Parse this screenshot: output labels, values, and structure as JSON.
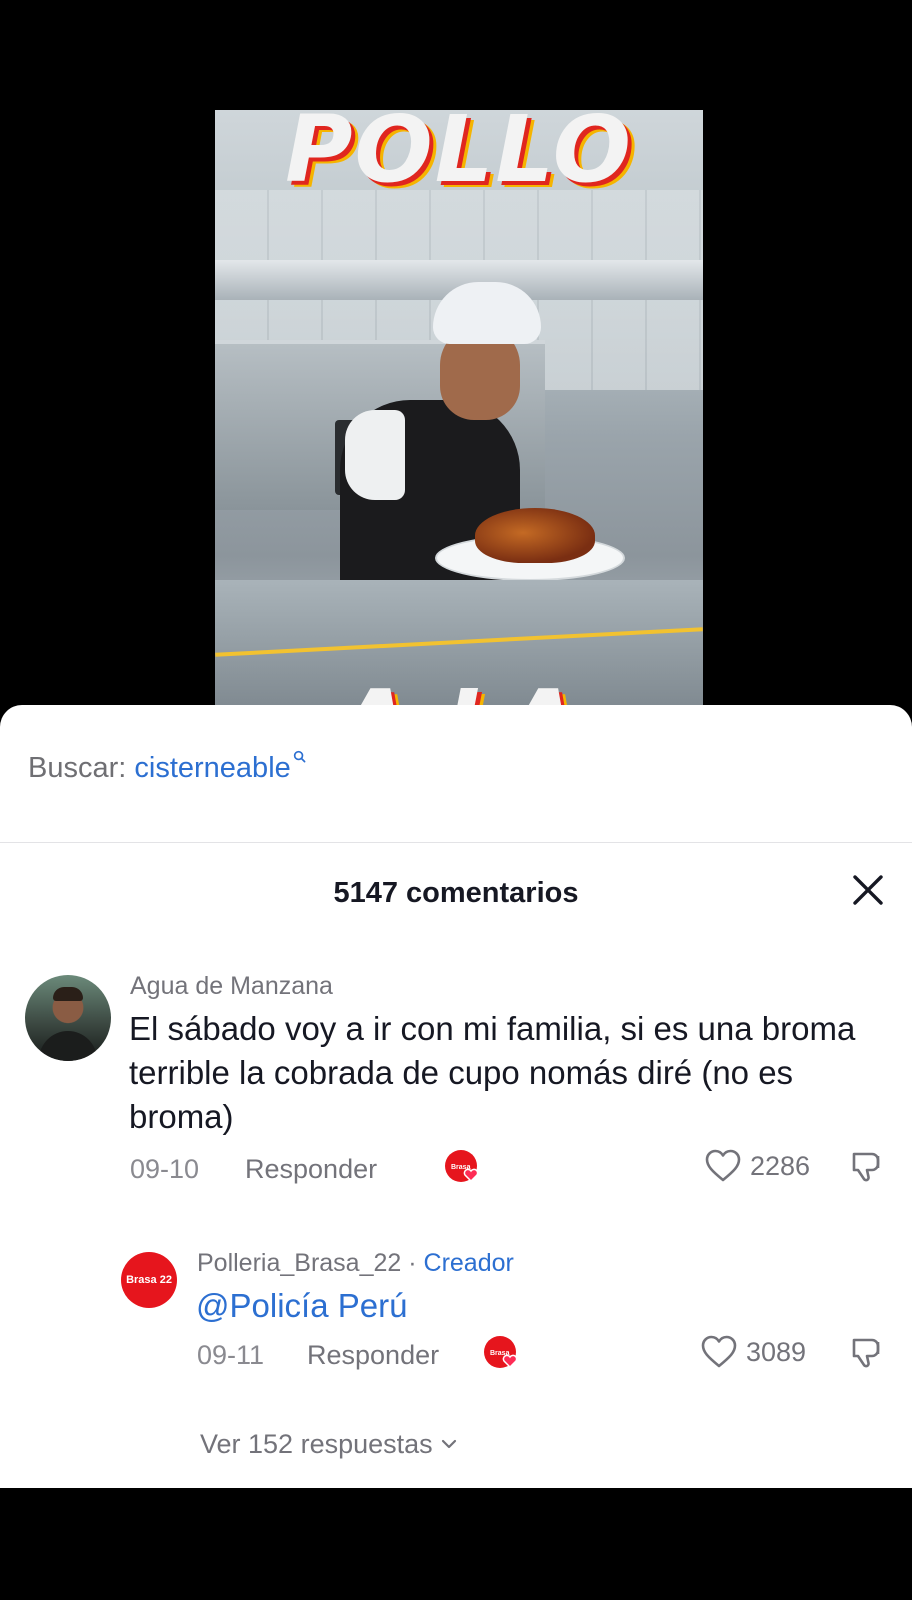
{
  "video": {
    "title_top": "POLLO",
    "title_bottom": "A LA BRASA"
  },
  "search": {
    "prefix": "Buscar:",
    "term": "cisterneable"
  },
  "comments_header": {
    "count_label": "5147 comentarios"
  },
  "comments": [
    {
      "username": "Agua de Manzana",
      "text": "El sábado voy a ir con mi familia, si es una broma terrible la cobrada de cupo nomás diré (no es broma)",
      "date": "09-10",
      "reply_label": "Responder",
      "likes": "2286"
    }
  ],
  "reply": {
    "username": "Polleria_Brasa_22",
    "separator": " · ",
    "tag": "Creador",
    "avatar_text": "Brasa 22",
    "mention": "@Policía Perú",
    "date": "09-11",
    "reply_label": "Responder",
    "likes": "3089"
  },
  "view_more": {
    "label": "Ver 152 respuestas"
  },
  "colors": {
    "accent_blue": "#2c6fd1",
    "brand_red": "#e6151d",
    "text_primary": "#161823",
    "text_secondary": "#73737a"
  },
  "icons": {
    "close": "close-icon",
    "search": "search-icon",
    "like": "heart-outline-icon",
    "dislike": "thumbs-down-icon",
    "creator_liked": "creator-heart-badge-icon",
    "expand": "chevron-down-icon"
  }
}
